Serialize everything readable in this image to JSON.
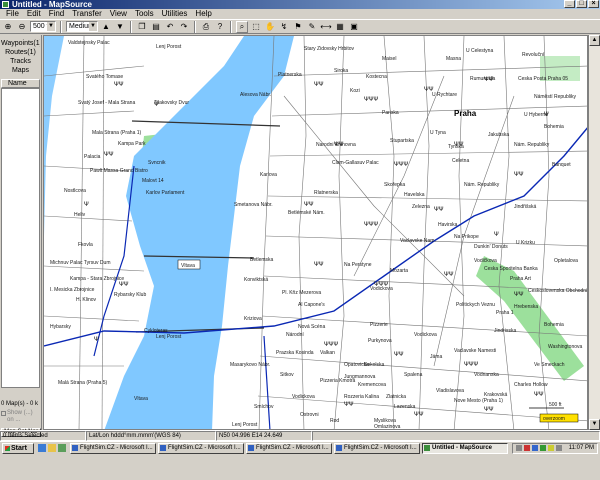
{
  "window": {
    "title": "Untitled - MapSource"
  },
  "menu": [
    "File",
    "Edit",
    "Find",
    "Transfer",
    "View",
    "Tools",
    "Utilities",
    "Help"
  ],
  "toolbar": {
    "scale_value": "500 ft",
    "detail_value": "Medium"
  },
  "leftpanel": {
    "tabs": [
      "Waypoints(1)",
      "Routes(1)",
      "Tracks",
      "Maps"
    ],
    "column_header": "Name",
    "maps_summary": "0 Map(s) - 0 k",
    "checkbox_label": "Show (...)",
    "checkbox_label2": "on ...",
    "mapset_button": "Map Set Nar"
  },
  "map": {
    "river_label": "Vltava",
    "city_label": "Praha",
    "scale_label": "500 ft",
    "zoom_label": "overzoom",
    "labels_top_left": [
      "Valdstejnsky Palac",
      "Svatého Tomase",
      "Svatý Josef - Mala Strana",
      "Tilakovsky Dvur",
      "Mala Strana (Praha 1)",
      "Kampa Park",
      "Palacia",
      "Pawlt Massa Grand Bistro",
      "Malovt 14",
      "Svncnik",
      "Karlov Parlament",
      "Nostlcova",
      "Heliv",
      "Fkovla",
      "Michnuv Palac Tyrsuv Dum",
      "Kampa - Stara Zbrojnice",
      "I. Mesicka Zbrojnice",
      "Rybarsky Klub",
      "H. Klinov",
      "Hybarsky",
      "Cykloteras",
      "Malá Strana (Praha 5)",
      "Vltava"
    ],
    "labels_center": [
      "Lenj Porost",
      "Alesova Nábr.",
      "Platnerska",
      "Karlova",
      "Clam-Gallasuv Palac",
      "Narodni Knihovna",
      "Konviktská",
      "Betlemska",
      "Betlémské Nám.",
      "Smetanova Nábr.",
      "Masarykovo Nábr.",
      "Pl. Kňz Mezerova",
      "Al Capone's",
      "Kriziova",
      "Nová Scéna",
      "Na Perstyne",
      "Národní",
      "Vodickova",
      "Mozarta",
      "Skořepka",
      "Rlatnerska",
      "Vaclavske Nam.",
      "Nám. Republiky",
      "Valkan",
      "Pizzeria Kmotra",
      "Opatovicka",
      "Purkynova",
      "Lazenska",
      "Vodickova",
      "Pizzerie",
      "Kremencova",
      "Rozzeria Kalina"
    ],
    "labels_top": [
      "Stary Zidovsky Hrbitov",
      "Maisel",
      "Siroka",
      "Kozi",
      "Kostecna",
      "Pariska",
      "U Celestyna",
      "Rumuncula",
      "Masna",
      "U Rychtare",
      "Praha",
      "Stupartska",
      "U Tyna",
      "Ceska Posta Praha 05",
      "Tynska",
      "Celetna",
      "Jakubska",
      "Bohemia",
      "Banquet",
      "Nám. Republiky",
      "Revoluční",
      "Náměstí Republiky"
    ],
    "labels_right": [
      "Havelska",
      "Zelezna",
      "Havirska",
      "Na Prikope",
      "Dunkin' Donuts",
      "Jindřišská",
      "Vodičkova",
      "Praha Art",
      "Ceskoslovenska Obchodni",
      "Ceska Sporitelna Banka",
      "U Krizku",
      "Hrebenska",
      "Bohemia",
      "Opletalova",
      "Politickych Veznu",
      "Jindrisska",
      "Washingtonova",
      "Nove Mesto (Praha 1)",
      "Vaclavske Namesti",
      "Praha 1",
      "Jáma",
      "Vodnanska",
      "Charles Hollow",
      "Krakovská",
      "Ve Smeckach",
      "U Hybernu"
    ],
    "labels_bottom": [
      "Lenj Porost",
      "Prazska Kosinda",
      "Rod",
      "Sitkov",
      "Myslikova",
      "Spalena",
      "Vodickova",
      "Vladislavova",
      "Ostrovni",
      "Zlatnicka",
      "Smíchov",
      "Sokolska",
      "Omlazinova",
      "Lenj Porost",
      "Jungmannova"
    ]
  },
  "statusbar": {
    "selection": "0 Items Selected",
    "lat_lon": "Lat/Lon hddd°mm.mmm'(WGS 84)",
    "coords": "N50 04.996 E14 24.649"
  },
  "taskbar": {
    "start": "Start",
    "tasks": [
      {
        "label": "FlightSim.CZ - Microsoft I...",
        "active": false
      },
      {
        "label": "FlightSim.CZ - Microsoft I...",
        "active": false
      },
      {
        "label": "FlightSim.CZ - Microsoft I...",
        "active": false
      },
      {
        "label": "FlightSim.CZ - Microsoft I...",
        "active": false
      },
      {
        "label": "Untitled - MapSource",
        "active": true
      }
    ],
    "clock": "11:07 PM"
  },
  "colors": {
    "river": "#80c8ff",
    "route": "#0a28b4",
    "park": "#9ce09c",
    "street": "#707070",
    "titlebar": "#0a246a"
  }
}
